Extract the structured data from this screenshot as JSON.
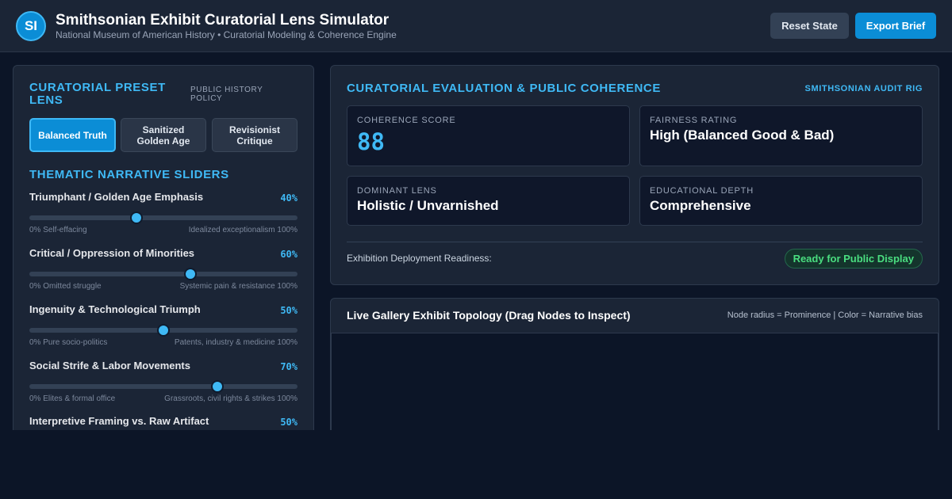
{
  "header": {
    "logo_text": "SI",
    "title": "Smithsonian Exhibit Curatorial Lens Simulator",
    "subtitle": "National Museum of American History • Curatorial Modeling & Coherence Engine",
    "reset_label": "Reset State",
    "export_label": "Export Brief"
  },
  "presets": {
    "title": "Curatorial Preset Lens",
    "policy": "Public History Policy",
    "items": [
      {
        "label": "Balanced Truth",
        "active": true
      },
      {
        "label": "Sanitized Golden Age",
        "active": false
      },
      {
        "label": "Revisionist Critique",
        "active": false
      }
    ]
  },
  "sliders": {
    "title": "Thematic Narrative Sliders",
    "items": [
      {
        "label": "Triumphant / Golden Age Emphasis",
        "value": 40,
        "value_text": "40%",
        "min_label": "0% Self-effacing",
        "max_label": "Idealized exceptionalism 100%"
      },
      {
        "label": "Critical / Oppression of Minorities",
        "value": 60,
        "value_text": "60%",
        "min_label": "0% Omitted struggle",
        "max_label": "Systemic pain & resistance 100%"
      },
      {
        "label": "Ingenuity & Technological Triumph",
        "value": 50,
        "value_text": "50%",
        "min_label": "0% Pure socio-politics",
        "max_label": "Patents, industry & medicine 100%"
      },
      {
        "label": "Social Strife & Labor Movements",
        "value": 70,
        "value_text": "70%",
        "min_label": "0% Elites & formal office",
        "max_label": "Grassroots, civil rights & strikes 100%"
      },
      {
        "label": "Interpretive Framing vs. Raw Artifact",
        "value": 50,
        "value_text": "50%",
        "min_label": "",
        "max_label": ""
      }
    ]
  },
  "evaluation": {
    "title": "Curatorial Evaluation & Public Coherence",
    "audit_label": "SMITHSONIAN AUDIT RIG",
    "coherence_label": "Coherence Score",
    "coherence_value": "88",
    "fairness_label": "Fairness Rating",
    "fairness_value": "High (Balanced Good & Bad)",
    "lens_label": "Dominant Lens",
    "lens_value": "Holistic / Unvarnished",
    "depth_label": "Educational Depth",
    "depth_value": "Comprehensive",
    "readiness_label": "Exhibition Deployment Readiness:",
    "readiness_status": "Ready for Public Display"
  },
  "topology": {
    "title": "Live Gallery Exhibit Topology (Drag Nodes to Inspect)",
    "legend": "Node radius = Prominence | Color = Narrative bias"
  }
}
